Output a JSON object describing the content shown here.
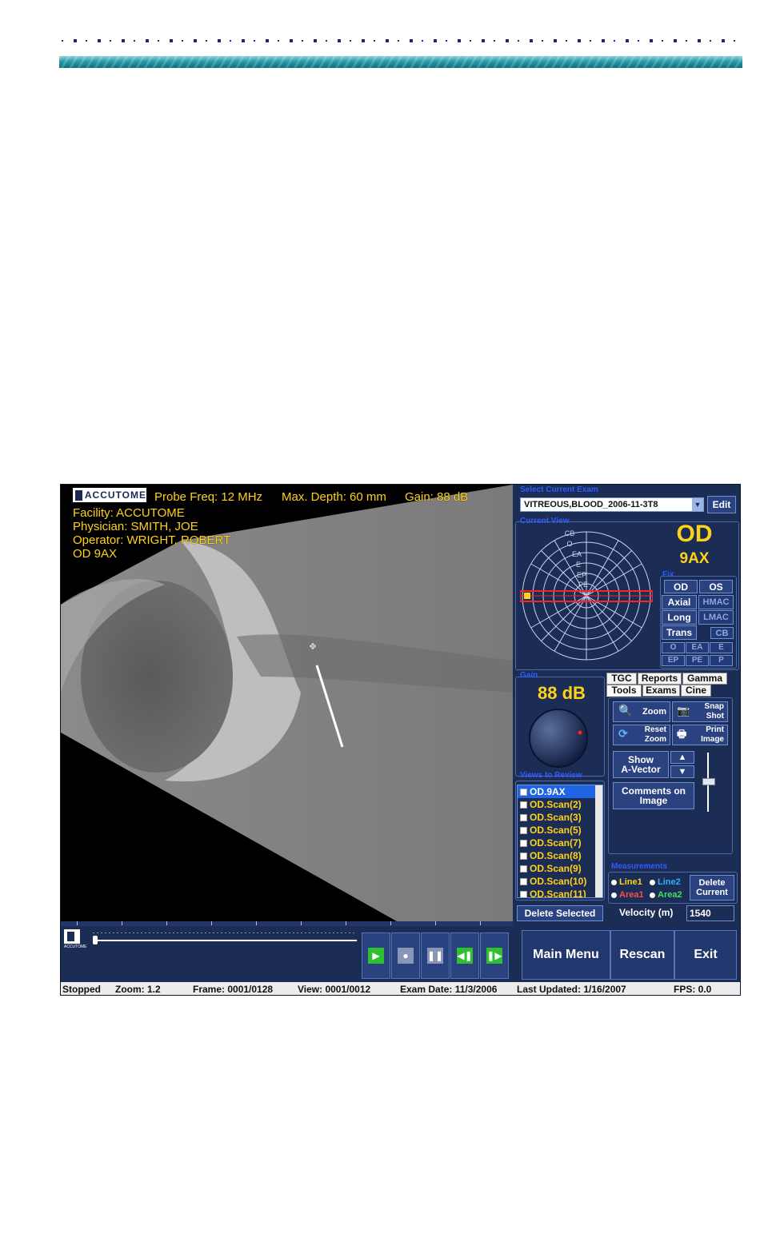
{
  "viewer": {
    "logo": "ACCUTOME",
    "probe_freq": "Probe Freq: 12 MHz",
    "max_depth": "Max. Depth: 60 mm",
    "gain": "Gain: 88 dB",
    "facility": "Facility: ACCUTOME",
    "physician": "Physician: SMITH, JOE",
    "operator": "Operator: WRIGHT, ROBERT",
    "view": "OD 9AX"
  },
  "exam": {
    "title": "Select Current Exam",
    "selected": "VITREOUS,BLOOD_2006-11-3T8",
    "edit": "Edit"
  },
  "current_view": {
    "title": "Current View",
    "eye": "OD",
    "position": "9AX",
    "radial_labels": [
      "CB",
      "O",
      "EA",
      "E",
      "EP",
      "PE"
    ],
    "fix_title": "Fix",
    "buttons": [
      "OD",
      "OS",
      "Axial",
      "HMAC",
      "Long",
      "LMAC",
      "Trans",
      "CB",
      "O",
      "EA",
      "E",
      "EP",
      "PE",
      "P"
    ]
  },
  "gain_panel": {
    "title": "Gain",
    "value": "88 dB"
  },
  "tabs_row1": [
    "TGC",
    "Reports",
    "Gamma"
  ],
  "tabs_row2": [
    "Tools",
    "Exams",
    "Cine"
  ],
  "tools": {
    "zoom": "Zoom",
    "snap_shot_1": "Snap",
    "snap_shot_2": "Shot",
    "reset_zoom_1": "Reset",
    "reset_zoom_2": "Zoom",
    "print_image_1": "Print",
    "print_image_2": "Image",
    "show_a_vector_1": "Show",
    "show_a_vector_2": "A-Vector",
    "comments_1": "Comments on",
    "comments_2": "Image"
  },
  "views": {
    "title": "Views to Review",
    "items": [
      "OD.9AX",
      "OD.Scan(2)",
      "OD.Scan(3)",
      "OD.Scan(5)",
      "OD.Scan(7)",
      "OD.Scan(8)",
      "OD.Scan(9)",
      "OD.Scan(10)",
      "OD.Scan(11)"
    ],
    "delete": "Delete Selected"
  },
  "measurements": {
    "title": "Measurements",
    "line1": "Line1",
    "line2": "Line2",
    "area1": "Area1",
    "area2": "Area2",
    "delete_1": "Delete",
    "delete_2": "Current",
    "velocity_label": "Velocity (m)",
    "velocity_value": "1540"
  },
  "bottom": {
    "logo": "ACCUTOME",
    "main_menu": "Main Menu",
    "rescan": "Rescan",
    "exit": "Exit"
  },
  "status": {
    "state": "Stopped",
    "zoom": "Zoom: 1.2",
    "frame": "Frame: 0001/0128",
    "view": "View: 0001/0012",
    "exam_date": "Exam Date: 11/3/2006",
    "last_updated": "Last Updated: 1/16/2007",
    "fps": "FPS: 0.0"
  },
  "colors": {
    "panel": "#1b2c55",
    "accent_yellow": "#ffd21a",
    "group_title": "#2f5cff",
    "selection": "#1f64e0"
  }
}
